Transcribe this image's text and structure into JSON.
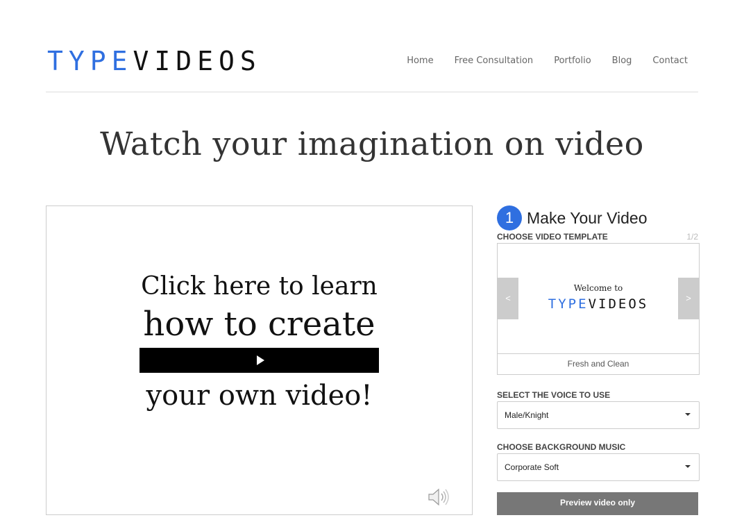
{
  "header": {
    "logo": {
      "part1": "TYPE",
      "part2": "VIDEOS"
    },
    "nav": [
      {
        "label": "Home"
      },
      {
        "label": "Free Consultation"
      },
      {
        "label": "Portfolio"
      },
      {
        "label": "Blog"
      },
      {
        "label": "Contact"
      }
    ]
  },
  "hero": {
    "headline": "Watch your imagination on video"
  },
  "video": {
    "line1": "Click here to learn",
    "line2": "how to create",
    "line3": "your own video!"
  },
  "builder": {
    "step_number": "1",
    "step_title": "Make Your Video",
    "template_label": "CHOOSE VIDEO TEMPLATE",
    "template_pager": "1/2",
    "template_preview": {
      "welcome": "Welcome to",
      "logo_part1": "TYPE",
      "logo_part2": "VIDEOS"
    },
    "prev_label": "<",
    "next_label": ">",
    "template_name": "Fresh and Clean",
    "voice_label": "SELECT THE VOICE TO USE",
    "voice_value": "Male/Knight",
    "music_label": "CHOOSE BACKGROUND MUSIC",
    "music_value": "Corporate Soft",
    "preview_button": "Preview video only"
  },
  "colors": {
    "brand_blue": "#2f6fe0",
    "button_gray": "#777777"
  }
}
